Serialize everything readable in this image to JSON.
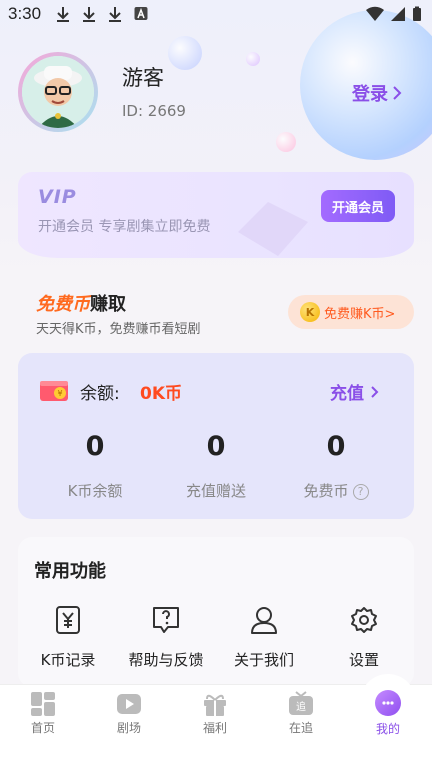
{
  "status_bar": {
    "time": "3:30"
  },
  "profile": {
    "username": "游客",
    "user_id": "ID: 2669",
    "login_label": "登录"
  },
  "vip": {
    "logo_text": "VIP",
    "description": "开通会员   专享剧集立即免费",
    "button_label": "开通会员"
  },
  "free_coin": {
    "title_highlight": "免费币",
    "title_rest": "赚取",
    "subtitle": "天天得K币，免费赚币看短剧",
    "button_icon_text": "K",
    "button_label": "免费赚K币>"
  },
  "balance": {
    "label": "余额:",
    "value": "0K币",
    "recharge_label": "充值",
    "stats": [
      {
        "value": "0",
        "label": "K币余额"
      },
      {
        "value": "0",
        "label": "充值赠送"
      },
      {
        "value": "0",
        "label": "免费币"
      }
    ],
    "help_symbol": "?"
  },
  "functions": {
    "title": "常用功能",
    "items": [
      {
        "label": "K币记录",
        "icon": "yen-record-icon"
      },
      {
        "label": "帮助与反馈",
        "icon": "help-feedback-icon"
      },
      {
        "label": "关于我们",
        "icon": "person-icon"
      },
      {
        "label": "设置",
        "icon": "gear-icon"
      }
    ]
  },
  "tabbar": {
    "items": [
      {
        "label": "首页",
        "icon": "home-icon"
      },
      {
        "label": "剧场",
        "icon": "play-icon"
      },
      {
        "label": "福利",
        "icon": "gift-icon"
      },
      {
        "label": "在追",
        "icon": "tv-icon",
        "icon_text": "追"
      },
      {
        "label": "我的",
        "icon": "chat-bubble-icon",
        "active": true
      }
    ]
  },
  "colors": {
    "accent": "#8a4fe8",
    "coin_orange": "#ff4a1f",
    "balance_card": "#e5e5fb"
  }
}
